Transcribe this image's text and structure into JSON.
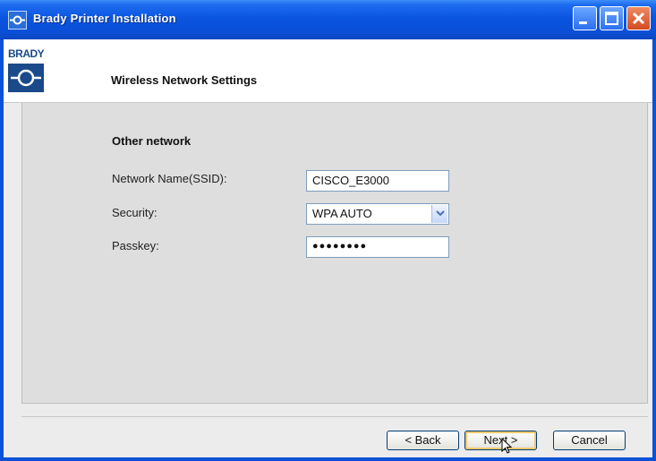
{
  "window": {
    "title": "Brady Printer Installation"
  },
  "header": {
    "logo_text": "BRADY",
    "title": "Wireless Network Settings"
  },
  "form": {
    "section_title": "Other network",
    "ssid_label": "Network Name(SSID):",
    "ssid_value": "CISCO_E3000",
    "security_label": "Security:",
    "security_value": "WPA AUTO",
    "passkey_label": "Passkey:",
    "passkey_value": "●●●●●●●●"
  },
  "buttons": {
    "back": "< Back",
    "next": "Next >",
    "cancel": "Cancel"
  },
  "icons": {
    "title_icon": "brady-logo-icon",
    "minimize": "minimize-icon",
    "maximize": "maximize-icon",
    "close": "close-icon",
    "select_arrow": "chevron-down-icon",
    "cursor": "mouse-pointer-icon"
  },
  "colors": {
    "titlebar": "#0a52d8",
    "close_button": "#d24a20",
    "brand": "#1a4a8a"
  }
}
